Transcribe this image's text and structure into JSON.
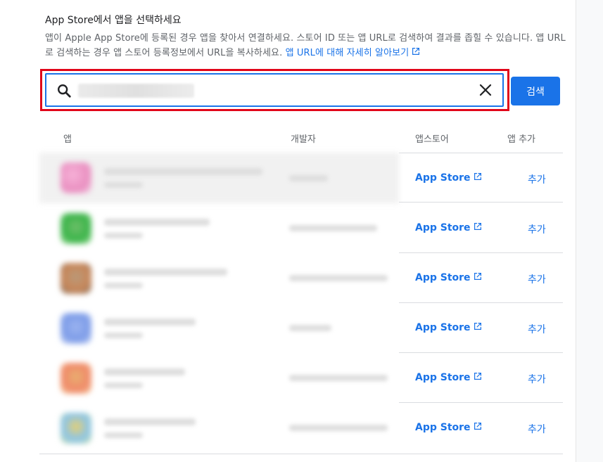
{
  "header": {
    "title": "App Store에서 앱을 선택하세요",
    "description": "앱이 Apple App Store에 등록된 경우 앱을 찾아서 연결하세요. 스토어 ID 또는 앱 URL로 검색하여 결과를 좁힐 수 있습니다. 앱 URL로 검색하는 경우 앱 스토어 등록정보에서 URL을 복사하세요.",
    "help_link": "앱 URL에 대해 자세히 알아보기"
  },
  "search": {
    "value": "",
    "button_label": "검색"
  },
  "table": {
    "columns": [
      "앱",
      "개발자",
      "앱스토어",
      "앱 추가"
    ],
    "rows": [
      {
        "store_label": "App Store",
        "add_label": "추가"
      },
      {
        "store_label": "App Store",
        "add_label": "추가"
      },
      {
        "store_label": "App Store",
        "add_label": "추가"
      },
      {
        "store_label": "App Store",
        "add_label": "추가"
      },
      {
        "store_label": "App Store",
        "add_label": "추가"
      },
      {
        "store_label": "App Store",
        "add_label": "추가"
      }
    ]
  },
  "colors": {
    "accent": "#1a73e8",
    "highlight": "#e1061a"
  }
}
